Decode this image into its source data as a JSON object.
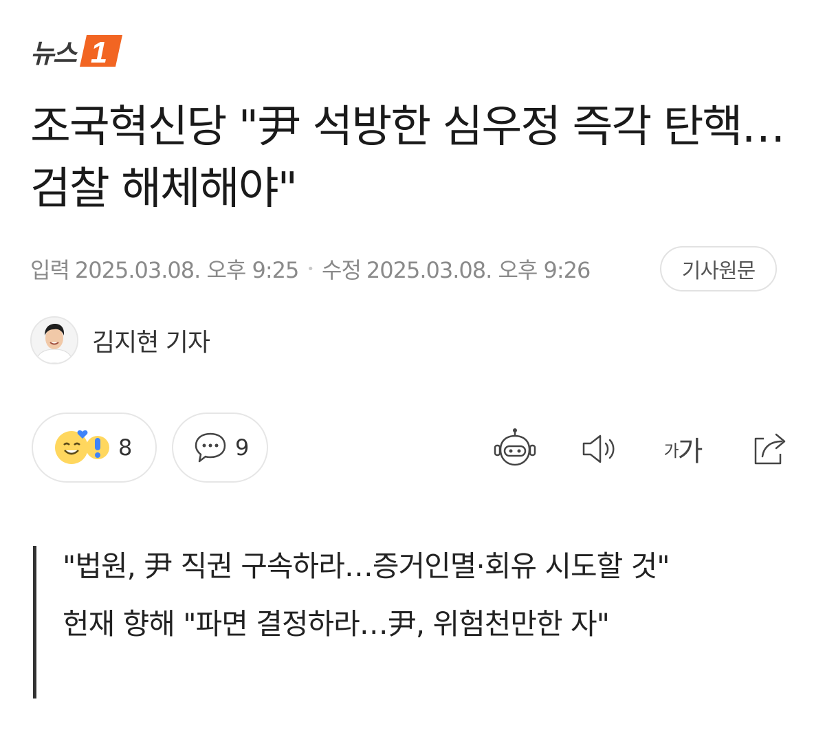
{
  "brand": {
    "logo_text": "뉴스",
    "logo_number": "1",
    "accent_color": "#f26522"
  },
  "article": {
    "headline": "조국혁신당 \"尹 석방한 심우정 즉각 탄핵…검찰 해체해야\"",
    "meta": {
      "published_label": "입력",
      "published": "2025.03.08. 오후 9:25",
      "updated_label": "수정",
      "updated": "2025.03.08. 오후 9:26",
      "original_button": "기사원문"
    },
    "author": {
      "name": "김지현 기자",
      "avatar_icon": "reporter-avatar"
    },
    "reactions": {
      "count": "8",
      "icons": [
        "smile-heart-icon",
        "surprise-icon"
      ]
    },
    "comments": {
      "count": "9",
      "icon": "comment-bubble-icon"
    },
    "toolbar": {
      "summary_icon": "robot-icon",
      "tts_icon": "speaker-icon",
      "font_size_label_small": "가",
      "font_size_label_large": "가",
      "share_icon": "share-icon"
    },
    "subheads": [
      "\"법원, 尹 직권 구속하라…증거인멸·회유 시도할 것\"",
      "헌재 향해 \"파면 결정하라…尹, 위험천만한 자\""
    ]
  }
}
